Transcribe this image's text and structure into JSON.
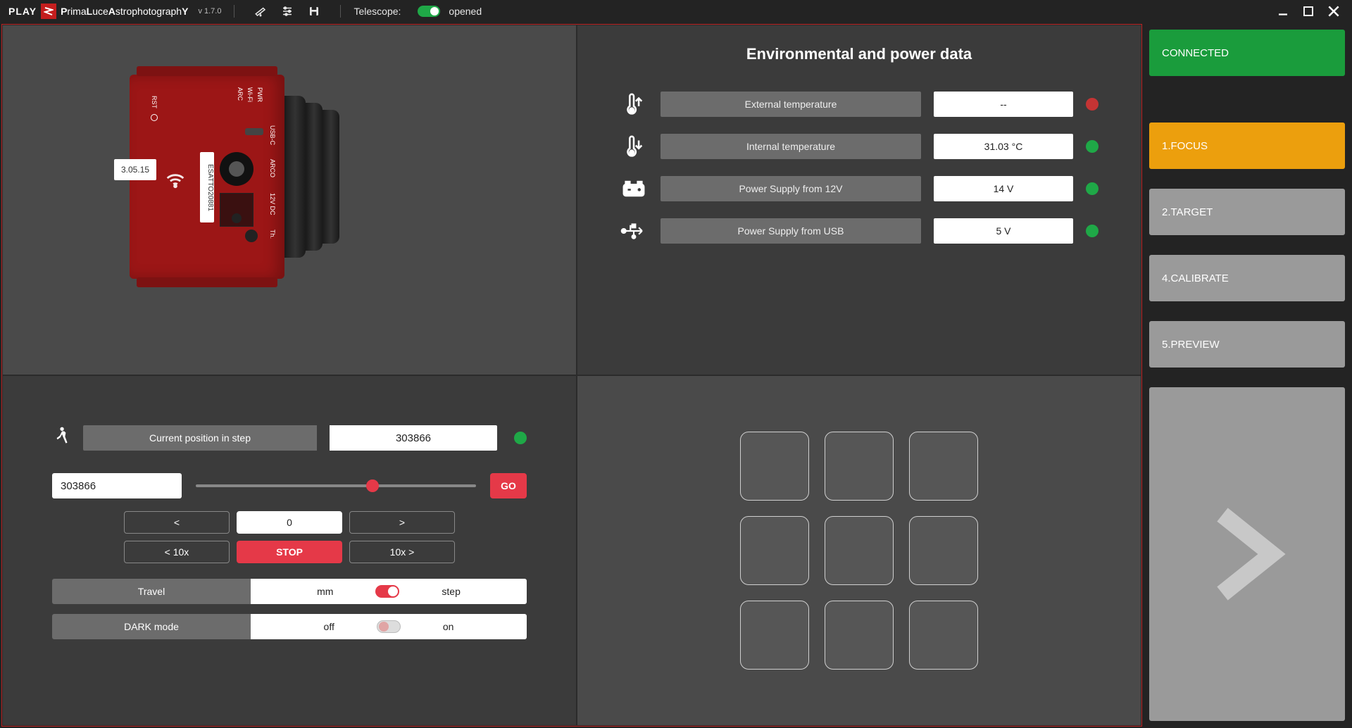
{
  "header": {
    "play": "PLAY",
    "brand_html": "PrimaLuceAstrophotographY",
    "version": "v 1.7.0",
    "telescope_label": "Telescope:",
    "telescope_state": "opened"
  },
  "sidebar": {
    "connected": "CONNECTED",
    "items": [
      "1.FOCUS",
      "2.TARGET",
      "4.CALIBRATE",
      "5.PREVIEW"
    ]
  },
  "device": {
    "fw": "3.05.15",
    "name": "ESATTO20881",
    "ports": {
      "pwr": "PWR",
      "wifi": "Wi-Fi",
      "arc": "ARC",
      "rst": "RST",
      "usbc": "USB-C",
      "arco": "ARCO",
      "dc": "12V DC",
      "th": "Th."
    }
  },
  "env": {
    "title": "Environmental and power data",
    "rows": [
      {
        "label": "External temperature",
        "value": "--",
        "led": "red"
      },
      {
        "label": "Internal temperature",
        "value": "31.03 °C",
        "led": "green"
      },
      {
        "label": "Power Supply from 12V",
        "value": "14 V",
        "led": "green"
      },
      {
        "label": "Power Supply from USB",
        "value": "5 V",
        "led": "green"
      }
    ]
  },
  "focus": {
    "pos_label": "Current position in step",
    "pos_value": "303866",
    "input_value": "303866",
    "slider_pct": 63,
    "go": "GO",
    "btns": {
      "lt": "<",
      "zero": "0",
      "gt": ">",
      "lt10": "< 10x",
      "stop": "STOP",
      "gt10": "10x >"
    },
    "travel": {
      "label": "Travel",
      "left": "mm",
      "right": "step",
      "on": true
    },
    "dark": {
      "label": "DARK mode",
      "left": "off",
      "right": "on",
      "on": false
    }
  }
}
